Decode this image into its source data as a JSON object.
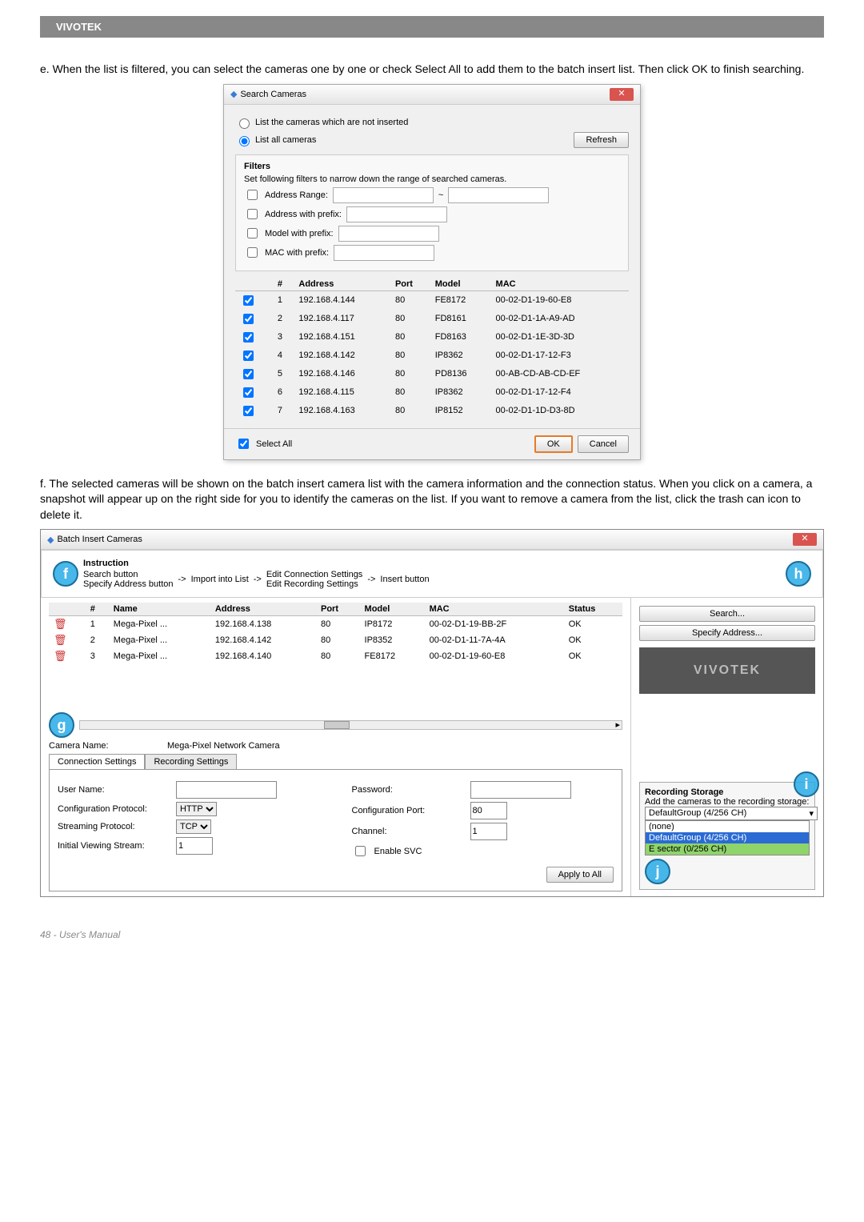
{
  "header": {
    "brand": "VIVOTEK"
  },
  "para_e": "e. When the list is filtered, you can select the cameras one by one or check Select All to add them to the batch insert list. Then click OK to finish searching.",
  "para_f": "f. The selected cameras will be shown on the batch insert camera list with the camera information and the connection status. When you click on a camera, a snapshot will appear up on the right side for you to identify the cameras on the list. If you want to remove a camera from the list, click the trash can icon to delete it.",
  "search_dialog": {
    "title": "Search Cameras",
    "radio_not_inserted": "List the cameras which are not inserted",
    "radio_all": "List all cameras",
    "refresh": "Refresh",
    "filters_title": "Filters",
    "filters_desc": "Set following filters to narrow down the range of searched cameras.",
    "f_addr_range": "Address Range:",
    "f_addr_prefix": "Address with prefix:",
    "f_model_prefix": "Model with prefix:",
    "f_mac_prefix": "MAC with prefix:",
    "range_sep": "~",
    "cols": {
      "num": "#",
      "address": "Address",
      "port": "Port",
      "model": "Model",
      "mac": "MAC"
    },
    "rows": [
      {
        "n": "1",
        "addr": "192.168.4.144",
        "port": "80",
        "model": "FE8172",
        "mac": "00-02-D1-19-60-E8"
      },
      {
        "n": "2",
        "addr": "192.168.4.117",
        "port": "80",
        "model": "FD8161",
        "mac": "00-02-D1-1A-A9-AD"
      },
      {
        "n": "3",
        "addr": "192.168.4.151",
        "port": "80",
        "model": "FD8163",
        "mac": "00-02-D1-1E-3D-3D"
      },
      {
        "n": "4",
        "addr": "192.168.4.142",
        "port": "80",
        "model": "IP8362",
        "mac": "00-02-D1-17-12-F3"
      },
      {
        "n": "5",
        "addr": "192.168.4.146",
        "port": "80",
        "model": "PD8136",
        "mac": "00-AB-CD-AB-CD-EF"
      },
      {
        "n": "6",
        "addr": "192.168.4.115",
        "port": "80",
        "model": "IP8362",
        "mac": "00-02-D1-17-12-F4"
      },
      {
        "n": "7",
        "addr": "192.168.4.163",
        "port": "80",
        "model": "IP8152",
        "mac": "00-02-D1-1D-D3-8D"
      }
    ],
    "select_all": "Select All",
    "ok": "OK",
    "cancel": "Cancel"
  },
  "batch": {
    "title": "Batch Insert Cameras",
    "instruction": "Instruction",
    "flow": {
      "search_button": "Search button",
      "specify_addr_button": "Specify Address button",
      "arrow": "->",
      "import_into_list": "Import into List",
      "edit_conn": "Edit Connection Settings",
      "edit_rec": "Edit Recording Settings",
      "insert_button": "Insert button"
    },
    "cols": {
      "num": "#",
      "name": "Name",
      "address": "Address",
      "port": "Port",
      "model": "Model",
      "mac": "MAC",
      "status": "Status"
    },
    "rows": [
      {
        "n": "1",
        "name": "Mega-Pixel ...",
        "addr": "192.168.4.138",
        "port": "80",
        "model": "IP8172",
        "mac": "00-02-D1-19-BB-2F",
        "status": "OK"
      },
      {
        "n": "2",
        "name": "Mega-Pixel ...",
        "addr": "192.168.4.142",
        "port": "80",
        "model": "IP8352",
        "mac": "00-02-D1-11-7A-4A",
        "status": "OK"
      },
      {
        "n": "3",
        "name": "Mega-Pixel ...",
        "addr": "192.168.4.140",
        "port": "80",
        "model": "FE8172",
        "mac": "00-02-D1-19-60-E8",
        "status": "OK"
      }
    ],
    "side": {
      "search": "Search...",
      "specify": "Specify Address...",
      "logo": "VIVOTEK"
    },
    "camera_name_label": "Camera Name:",
    "camera_name_value": "Mega-Pixel Network Camera",
    "tab_conn": "Connection Settings",
    "tab_rec": "Recording Settings",
    "form": {
      "user_name": "User Name:",
      "password": "Password:",
      "conf_protocol": "Configuration Protocol:",
      "conf_protocol_val": "HTTP",
      "conf_port": "Configuration Port:",
      "conf_port_val": "80",
      "stream_protocol": "Streaming Protocol:",
      "stream_protocol_val": "TCP",
      "channel": "Channel:",
      "channel_val": "1",
      "init_view": "Initial Viewing Stream:",
      "init_view_val": "1",
      "enable_svc": "Enable SVC",
      "apply_all": "Apply to All"
    },
    "storage": {
      "title": "Recording Storage",
      "desc": "Add the cameras to the recording storage:",
      "selected": "DefaultGroup (4/256 CH)",
      "opts": [
        "(none)",
        "DefaultGroup (4/256 CH)",
        "E sector (0/256 CH)"
      ]
    }
  },
  "markers": {
    "f": "f",
    "g": "g",
    "h": "h",
    "i": "i",
    "j": "j"
  },
  "footer": "48 - User's Manual"
}
